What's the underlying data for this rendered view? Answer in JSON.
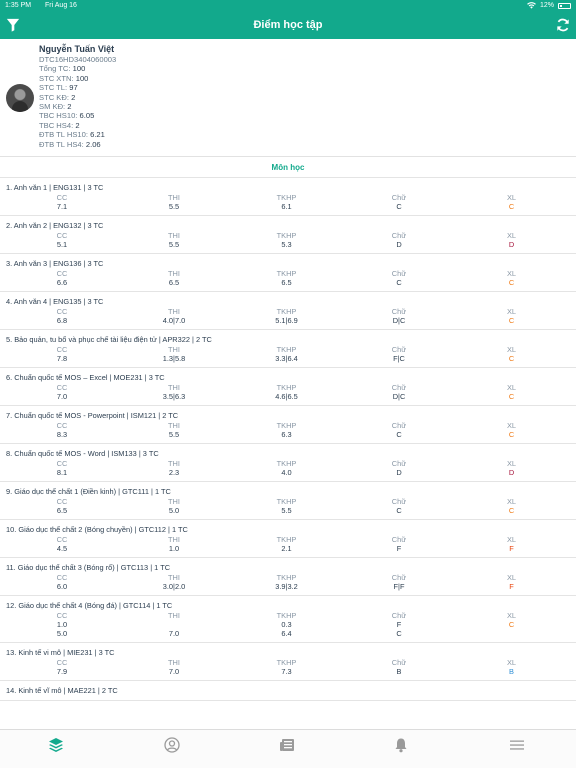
{
  "status_bar": {
    "time": "1:35 PM",
    "date": "Fri Aug 16",
    "battery": "12%"
  },
  "nav": {
    "title": "Điểm học tập",
    "left_icon": "filter-icon",
    "right_icon": "refresh-icon"
  },
  "profile": {
    "name": "Nguyễn Tuấn Việt",
    "student_id": "DTC16HD3404060003",
    "stats": [
      {
        "label": "Tổng TC:",
        "value": "100"
      },
      {
        "label": "STC XTN:",
        "value": "100"
      },
      {
        "label": "STC TL:",
        "value": "97"
      },
      {
        "label": "STC KĐ:",
        "value": "2"
      },
      {
        "label": "SM KĐ:",
        "value": "2"
      },
      {
        "label": "TBC HS10:",
        "value": "6.05"
      },
      {
        "label": "TBC HS4:",
        "value": "2"
      },
      {
        "label": "ĐTB TL HS10:",
        "value": "6.21"
      },
      {
        "label": "ĐTB TL HS4:",
        "value": "2.06"
      }
    ]
  },
  "section_title": "Môn học",
  "columns": [
    "CC",
    "THI",
    "TKHP",
    "Chữ",
    "XL"
  ],
  "courses": [
    {
      "title": "1. Anh văn 1 | ENG131 | 3 TC",
      "rows": [
        [
          "7.1",
          "5.5",
          "6.1",
          "C",
          "C"
        ]
      ],
      "xl_class": "C"
    },
    {
      "title": "2. Anh văn 2 | ENG132 | 3 TC",
      "rows": [
        [
          "5.1",
          "5.5",
          "5.3",
          "D",
          "D"
        ]
      ],
      "xl_class": "D"
    },
    {
      "title": "3. Anh văn 3 | ENG136 | 3 TC",
      "rows": [
        [
          "6.6",
          "6.5",
          "6.5",
          "C",
          "C"
        ]
      ],
      "xl_class": "C"
    },
    {
      "title": "4. Anh văn 4 | ENG135 | 3 TC",
      "rows": [
        [
          "6.8",
          "4.0|7.0",
          "5.1|6.9",
          "D|C",
          "C"
        ]
      ],
      "xl_class": "C"
    },
    {
      "title": "5. Bảo quản, tu bổ và phục chế tài liệu điện tử | APR322 | 2 TC",
      "rows": [
        [
          "7.8",
          "1.3|5.8",
          "3.3|6.4",
          "F|C",
          "C"
        ]
      ],
      "xl_class": "C"
    },
    {
      "title": "6. Chuẩn quốc tế MOS – Excel | MOE231 | 3 TC",
      "rows": [
        [
          "7.0",
          "3.5|6.3",
          "4.6|6.5",
          "D|C",
          "C"
        ]
      ],
      "xl_class": "C"
    },
    {
      "title": "7. Chuẩn quốc tế MOS - Powerpoint | ISM121 | 2 TC",
      "rows": [
        [
          "8.3",
          "5.5",
          "6.3",
          "C",
          "C"
        ]
      ],
      "xl_class": "C"
    },
    {
      "title": "8. Chuẩn quốc tế MOS - Word | ISM133 | 3 TC",
      "rows": [
        [
          "8.1",
          "2.3",
          "4.0",
          "D",
          "D"
        ]
      ],
      "xl_class": "D"
    },
    {
      "title": "9. Giáo dục thể chất 1 (Điền kinh) | GTC111 | 1 TC",
      "rows": [
        [
          "6.5",
          "5.0",
          "5.5",
          "C",
          "C"
        ]
      ],
      "xl_class": "C"
    },
    {
      "title": "10. Giáo dục thể chất 2 (Bóng chuyền) | GTC112 | 1 TC",
      "rows": [
        [
          "4.5",
          "1.0",
          "2.1",
          "F",
          "F"
        ]
      ],
      "xl_class": "F"
    },
    {
      "title": "11. Giáo dục thể chất 3 (Bóng rổ) | GTC113 | 1 TC",
      "rows": [
        [
          "6.0",
          "3.0|2.0",
          "3.9|3.2",
          "F|F",
          "F"
        ]
      ],
      "xl_class": "F"
    },
    {
      "title": "12. Giáo dục thể chất 4 (Bóng đá) | GTC114 | 1 TC",
      "rows": [
        [
          "1.0",
          "",
          "0.3",
          "F",
          "C"
        ],
        [
          "5.0",
          "7.0",
          "6.4",
          "C",
          ""
        ]
      ],
      "xl_class": "C"
    },
    {
      "title": "13. Kinh tế vi mô | MIE231 | 3 TC",
      "rows": [
        [
          "7.9",
          "7.0",
          "7.3",
          "B",
          "B"
        ]
      ],
      "xl_class": "B"
    },
    {
      "title": "14. Kinh tế vĩ mô | MAE221 | 2 TC",
      "rows": [],
      "xl_class": ""
    }
  ],
  "tabbar": {
    "items": [
      "layers-icon",
      "user-icon",
      "newspaper-icon",
      "bell-icon",
      "menu-icon"
    ],
    "active_index": 0
  },
  "colors": {
    "primary": "#12a98c",
    "grade_c": "#ef7a16",
    "grade_d": "#a6143c",
    "grade_f": "#e8450f",
    "grade_b": "#2f8fd6"
  }
}
